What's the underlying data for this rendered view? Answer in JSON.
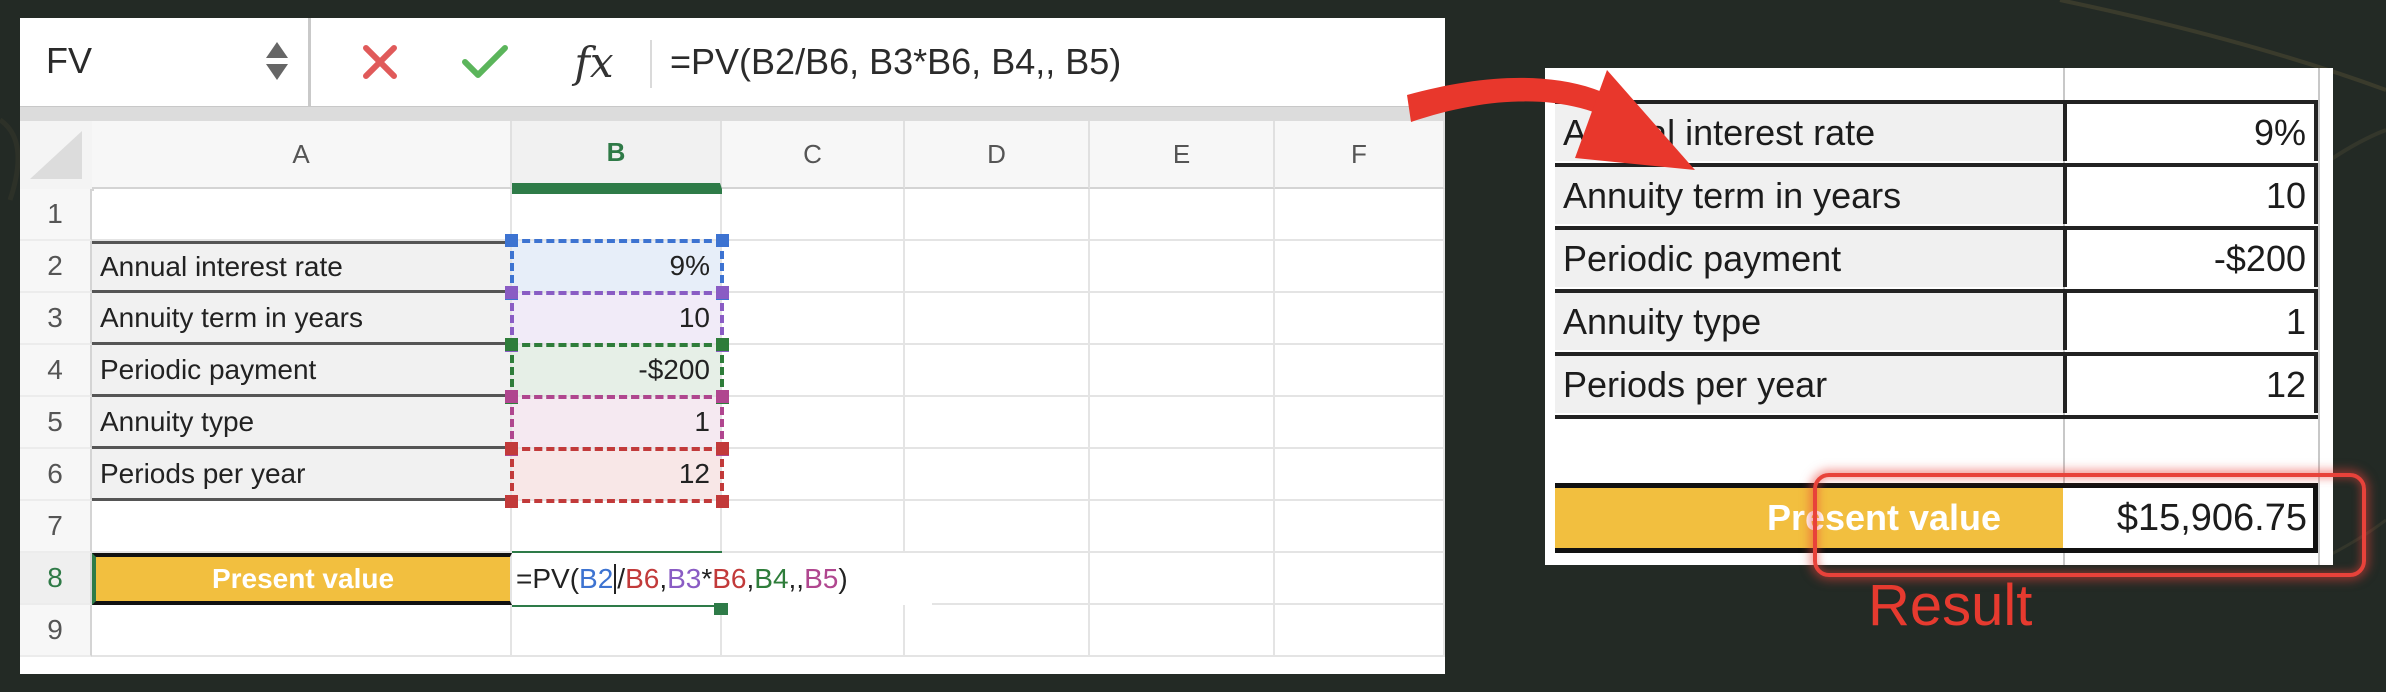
{
  "formula_bar": {
    "name_box": "FV",
    "formula": "=PV(B2/B6, B3*B6, B4,, B5)",
    "icons": {
      "cancel": "x-icon",
      "enter": "checkmark-icon",
      "function": "fx-icon",
      "spinner": "spinner-icon"
    }
  },
  "sheet": {
    "columns": [
      "A",
      "B",
      "C",
      "D",
      "E",
      "F"
    ],
    "selected_column": "B",
    "rows": [
      "1",
      "2",
      "3",
      "4",
      "5",
      "6",
      "7",
      "8",
      "9"
    ],
    "selected_row": "8",
    "inputs": [
      {
        "row": "2",
        "label": "Annual interest rate",
        "value": "9%",
        "ref": "B2",
        "color": "#3d73d1"
      },
      {
        "row": "3",
        "label": "Annuity term in years",
        "value": "10",
        "ref": "B3",
        "color": "#8a5cc4"
      },
      {
        "row": "4",
        "label": "Periodic payment",
        "value": "-$200",
        "ref": "B4",
        "color": "#2e7d3a"
      },
      {
        "row": "5",
        "label": "Annuity type",
        "value": "1",
        "ref": "B5",
        "color": "#b0468f"
      },
      {
        "row": "6",
        "label": "Periods per year",
        "value": "12",
        "ref": "B6",
        "color": "#c23a3a"
      }
    ],
    "result_label": "Present value",
    "editing_formula_parts": [
      {
        "text": "=PV(",
        "color": "#222222"
      },
      {
        "text": "B2",
        "color": "#3d73d1"
      },
      {
        "text": "/",
        "color": "#222222"
      },
      {
        "text": "B6",
        "color": "#c23a3a"
      },
      {
        "text": ", ",
        "color": "#222222"
      },
      {
        "text": "B3",
        "color": "#8a5cc4"
      },
      {
        "text": "*",
        "color": "#222222"
      },
      {
        "text": "B6",
        "color": "#c23a3a"
      },
      {
        "text": ", ",
        "color": "#222222"
      },
      {
        "text": "B4",
        "color": "#2e7d3a"
      },
      {
        "text": ",, ",
        "color": "#222222"
      },
      {
        "text": "B5",
        "color": "#b0468f"
      },
      {
        "text": ")",
        "color": "#222222"
      }
    ]
  },
  "result_panel": {
    "rows": [
      {
        "label": "Annual interest rate",
        "value": "9%"
      },
      {
        "label": "Annuity term in years",
        "value": "10"
      },
      {
        "label": "Periodic payment",
        "value": "-$200"
      },
      {
        "label": "Annuity type",
        "value": "1"
      },
      {
        "label": "Periods per year",
        "value": "12"
      }
    ],
    "result_label": "Present value",
    "result_value": "$15,906.75",
    "annotation": "Result"
  },
  "colors": {
    "background": "#232a25",
    "accent_green": "#2e7b48",
    "highlight_yellow": "#f2bf3f",
    "annotation_red": "#e63a2f"
  }
}
